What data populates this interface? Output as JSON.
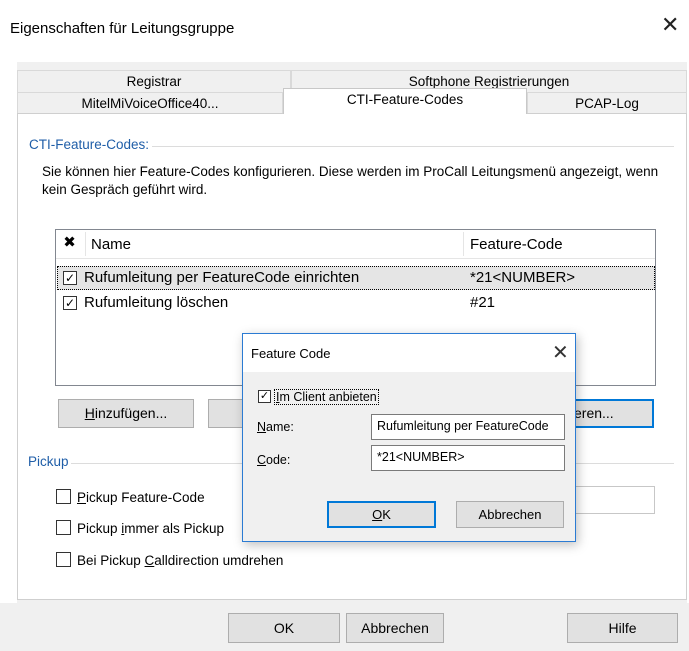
{
  "window": {
    "title": "Eigenschaften für Leitungsgruppe",
    "close_glyph": "✕"
  },
  "tabs": {
    "row_back": [
      {
        "label": "Registrar"
      },
      {
        "label": "Softphone Registrierungen"
      }
    ],
    "row_front": [
      {
        "label": "MitelMiVoiceOffice40..."
      },
      {
        "label": "CTI-Feature-Codes"
      },
      {
        "label": "PCAP-Log"
      }
    ],
    "selected": "CTI-Feature-Codes"
  },
  "cti_group": {
    "title": "CTI-Feature-Codes:",
    "description": "Sie können hier Feature-Codes konfigurieren. Diese werden im ProCall Leitungsmenü angezeigt, wenn kein Gespräch geführt wird.",
    "list": {
      "header_check": "✖",
      "columns": [
        "Name",
        "Feature-Code"
      ],
      "rows": [
        {
          "name": "Rufumleitung per FeatureCode einrichten",
          "code": "*21<NUMBER>",
          "checked": true,
          "selected": true
        },
        {
          "name": "Rufumleitung löschen",
          "code": "#21",
          "checked": true,
          "selected": false
        }
      ]
    },
    "buttons": {
      "add_prefix": "H",
      "add_rest": "inzufügen...",
      "edit_visible": "eren..."
    }
  },
  "pickup_group": {
    "title": "Pickup",
    "options": [
      {
        "pre": "",
        "ul": "P",
        "post": "ickup Feature-Code",
        "checked": false
      },
      {
        "pre": "Pickup ",
        "ul": "i",
        "post": "mmer als Pickup",
        "checked": false
      },
      {
        "pre": "Bei Pickup ",
        "ul": "C",
        "post": "alldirection umdrehen",
        "checked": false
      }
    ]
  },
  "footer": {
    "ok": "OK",
    "cancel": "Abbrechen",
    "help": "Hilfe"
  },
  "popup": {
    "title": "Feature Code",
    "close_glyph": "✕",
    "offer_in_client": {
      "ul": "I",
      "rest": "m Client anbieten",
      "checked": true
    },
    "name_label": {
      "ul": "N",
      "rest": "ame:"
    },
    "name_value": "Rufumleitung per FeatureCode",
    "code_label": {
      "ul": "C",
      "rest": "ode:"
    },
    "code_value": "*21<NUMBER>",
    "ok_ul": "O",
    "ok_rest": "K",
    "cancel": "Abbrechen"
  },
  "check_glyph": "✓",
  "colors": {
    "accent": "#0078d7",
    "group_title": "#1f5ea8",
    "selection": "#e5e5e5"
  }
}
